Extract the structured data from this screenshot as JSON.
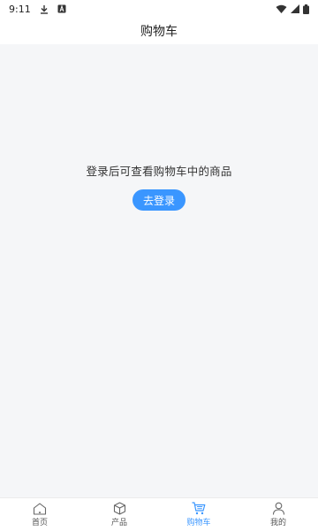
{
  "status_bar": {
    "time": "9:11",
    "icons": [
      "download-icon",
      "a-icon",
      "wifi-icon",
      "signal-icon",
      "battery-icon"
    ]
  },
  "header": {
    "title": "购物车"
  },
  "empty_state": {
    "message": "登录后可查看购物车中的商品",
    "login_button": "去登录"
  },
  "bottom_nav": {
    "items": [
      {
        "label": "首页",
        "icon": "home-icon",
        "active": false
      },
      {
        "label": "产品",
        "icon": "box-icon",
        "active": false
      },
      {
        "label": "购物车",
        "icon": "cart-icon",
        "active": true
      },
      {
        "label": "我的",
        "icon": "user-icon",
        "active": false
      }
    ]
  },
  "colors": {
    "accent": "#3a96ff",
    "background": "#f5f6f8",
    "surface": "#ffffff",
    "text": "#333333"
  }
}
